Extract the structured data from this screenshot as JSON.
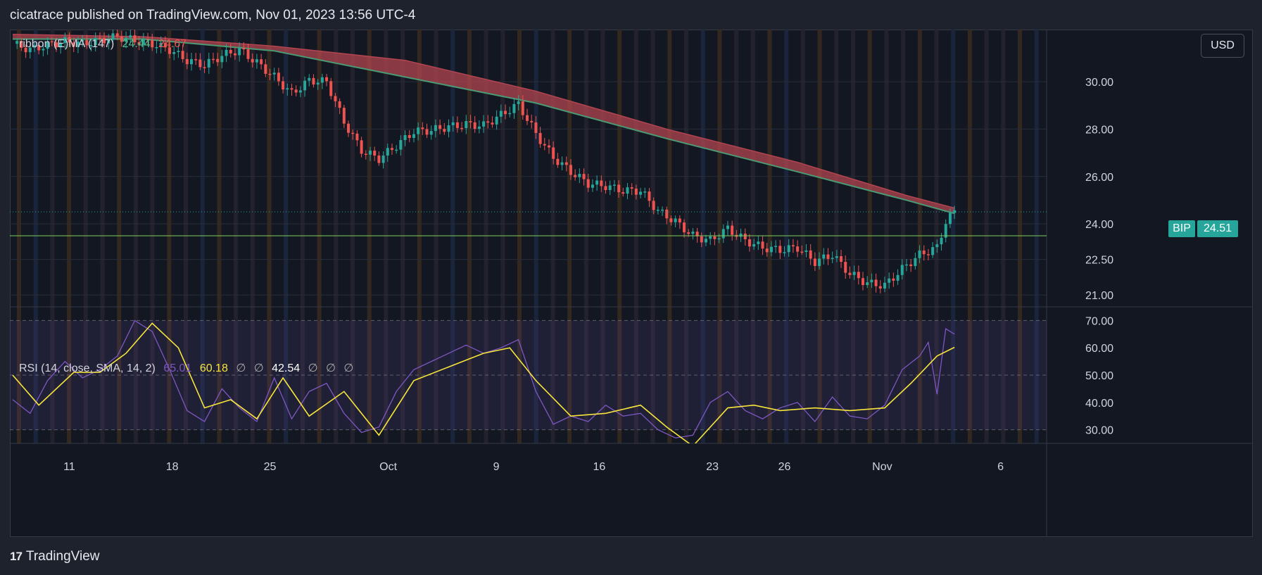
{
  "header": {
    "published_line": "cicatrace published on TradingView.com, Nov 01, 2023 13:56 UTC-4"
  },
  "currency_button": "USD",
  "symbol_badge": {
    "symbol": "BIP",
    "price": "24.51"
  },
  "ribbon_legend": {
    "name": "ribbon (E)MA (147)",
    "value_low": "24.44",
    "value_high": "24.67"
  },
  "rsi_legend": {
    "name": "RSI (14, close, SMA, 14, 2)",
    "rsi_value": "65.01",
    "ma_value": "60.18",
    "empty_1": "∅",
    "empty_2": "∅",
    "extra_value": "42.54",
    "empty_3": "∅",
    "empty_4": "∅",
    "empty_5": "∅"
  },
  "price_axis_labels": [
    "30.00",
    "28.00",
    "26.00",
    "24.00",
    "22.50",
    "21.00"
  ],
  "rsi_axis_labels": [
    "70.00",
    "60.00",
    "50.00",
    "40.00",
    "30.00"
  ],
  "time_axis_labels": [
    "11",
    "18",
    "25",
    "Oct",
    "9",
    "16",
    "23",
    "26",
    "Nov",
    "6"
  ],
  "footer": {
    "brand": "TradingView",
    "logo_mark": "17"
  },
  "colors": {
    "background": "#131722",
    "up": "#26a69a",
    "down": "#ef5350",
    "ribbon_bear": "#b24550",
    "ribbon_bull": "#4a9a74",
    "rsi": "#7e57c2",
    "rsi_ma": "#f7e53b",
    "support": "#7ccf5a"
  },
  "chart_data": [
    {
      "type": "candlestick",
      "series_label": "BIP",
      "x_axis_ticks": [
        "11",
        "18",
        "25",
        "Oct",
        "9",
        "16",
        "23",
        "26",
        "Nov",
        "6"
      ],
      "y_axis_ticks": [
        30.0,
        28.0,
        26.0,
        24.0,
        22.5,
        21.0
      ],
      "y_range": [
        20.5,
        32.2
      ],
      "last_price": 24.51,
      "horizontal_line": 23.5,
      "close_path": [
        {
          "x": 0,
          "y": 31.6
        },
        {
          "x": 4,
          "y": 31.35
        },
        {
          "x": 8,
          "y": 31.55
        },
        {
          "x": 12,
          "y": 31.7
        },
        {
          "x": 16,
          "y": 31.6
        },
        {
          "x": 20,
          "y": 31.75
        },
        {
          "x": 24,
          "y": 31.9
        },
        {
          "x": 28,
          "y": 31.75
        },
        {
          "x": 32,
          "y": 31.6
        },
        {
          "x": 36,
          "y": 31.35
        },
        {
          "x": 40,
          "y": 30.9
        },
        {
          "x": 44,
          "y": 30.7
        },
        {
          "x": 48,
          "y": 31.1
        },
        {
          "x": 52,
          "y": 31.35
        },
        {
          "x": 56,
          "y": 30.8
        },
        {
          "x": 60,
          "y": 30.2
        },
        {
          "x": 64,
          "y": 29.5
        },
        {
          "x": 68,
          "y": 30.05
        },
        {
          "x": 72,
          "y": 30.0
        },
        {
          "x": 76,
          "y": 28.3
        },
        {
          "x": 80,
          "y": 27.1
        },
        {
          "x": 84,
          "y": 26.75
        },
        {
          "x": 88,
          "y": 27.3
        },
        {
          "x": 92,
          "y": 27.9
        },
        {
          "x": 96,
          "y": 27.95
        },
        {
          "x": 100,
          "y": 28.1
        },
        {
          "x": 104,
          "y": 28.2
        },
        {
          "x": 108,
          "y": 28.15
        },
        {
          "x": 112,
          "y": 28.6
        },
        {
          "x": 116,
          "y": 29.05
        },
        {
          "x": 120,
          "y": 27.8
        },
        {
          "x": 124,
          "y": 26.8
        },
        {
          "x": 128,
          "y": 26.2
        },
        {
          "x": 132,
          "y": 25.7
        },
        {
          "x": 136,
          "y": 25.6
        },
        {
          "x": 140,
          "y": 25.4
        },
        {
          "x": 144,
          "y": 25.4
        },
        {
          "x": 148,
          "y": 24.55
        },
        {
          "x": 152,
          "y": 24.1
        },
        {
          "x": 156,
          "y": 23.5
        },
        {
          "x": 160,
          "y": 23.3
        },
        {
          "x": 164,
          "y": 23.8
        },
        {
          "x": 168,
          "y": 23.3
        },
        {
          "x": 172,
          "y": 23.0
        },
        {
          "x": 176,
          "y": 22.9
        },
        {
          "x": 180,
          "y": 23.0
        },
        {
          "x": 184,
          "y": 22.4
        },
        {
          "x": 188,
          "y": 22.7
        },
        {
          "x": 192,
          "y": 21.9
        },
        {
          "x": 196,
          "y": 21.5
        },
        {
          "x": 200,
          "y": 21.4
        },
        {
          "x": 204,
          "y": 22.1
        },
        {
          "x": 208,
          "y": 22.7
        },
        {
          "x": 212,
          "y": 23.0
        },
        {
          "x": 214,
          "y": 24.1
        },
        {
          "x": 216,
          "y": 24.51
        }
      ],
      "ema_ribbon": {
        "upper": [
          {
            "x": 0,
            "y": 32.0
          },
          {
            "x": 30,
            "y": 31.9
          },
          {
            "x": 60,
            "y": 31.5
          },
          {
            "x": 90,
            "y": 30.9
          },
          {
            "x": 120,
            "y": 29.6
          },
          {
            "x": 150,
            "y": 28.0
          },
          {
            "x": 180,
            "y": 26.6
          },
          {
            "x": 205,
            "y": 25.2
          },
          {
            "x": 216,
            "y": 24.67
          }
        ],
        "lower": [
          {
            "x": 0,
            "y": 31.8
          },
          {
            "x": 30,
            "y": 31.8
          },
          {
            "x": 60,
            "y": 31.3
          },
          {
            "x": 90,
            "y": 30.2
          },
          {
            "x": 120,
            "y": 29.1
          },
          {
            "x": 150,
            "y": 27.6
          },
          {
            "x": 180,
            "y": 26.2
          },
          {
            "x": 205,
            "y": 25.0
          },
          {
            "x": 216,
            "y": 24.44
          }
        ]
      }
    },
    {
      "type": "line",
      "series_label": "RSI (14, close, SMA, 14, 2)",
      "y_axis_ticks": [
        70.0,
        60.0,
        50.0,
        40.0,
        30.0
      ],
      "y_range": [
        25,
        75
      ],
      "bands": [
        30,
        50,
        70
      ],
      "series": [
        {
          "name": "RSI",
          "points": [
            {
              "x": 0,
              "y": 41
            },
            {
              "x": 4,
              "y": 36
            },
            {
              "x": 8,
              "y": 48
            },
            {
              "x": 12,
              "y": 55
            },
            {
              "x": 16,
              "y": 49
            },
            {
              "x": 20,
              "y": 52
            },
            {
              "x": 24,
              "y": 57
            },
            {
              "x": 28,
              "y": 70
            },
            {
              "x": 32,
              "y": 66
            },
            {
              "x": 36,
              "y": 52
            },
            {
              "x": 40,
              "y": 37
            },
            {
              "x": 44,
              "y": 33
            },
            {
              "x": 48,
              "y": 45
            },
            {
              "x": 52,
              "y": 38
            },
            {
              "x": 56,
              "y": 33
            },
            {
              "x": 60,
              "y": 49
            },
            {
              "x": 64,
              "y": 34
            },
            {
              "x": 68,
              "y": 44
            },
            {
              "x": 72,
              "y": 47
            },
            {
              "x": 76,
              "y": 36
            },
            {
              "x": 80,
              "y": 29
            },
            {
              "x": 84,
              "y": 31
            },
            {
              "x": 88,
              "y": 44
            },
            {
              "x": 92,
              "y": 52
            },
            {
              "x": 96,
              "y": 55
            },
            {
              "x": 100,
              "y": 58
            },
            {
              "x": 104,
              "y": 61
            },
            {
              "x": 108,
              "y": 58
            },
            {
              "x": 112,
              "y": 60
            },
            {
              "x": 116,
              "y": 63
            },
            {
              "x": 120,
              "y": 44
            },
            {
              "x": 124,
              "y": 32
            },
            {
              "x": 128,
              "y": 35
            },
            {
              "x": 132,
              "y": 33
            },
            {
              "x": 136,
              "y": 39
            },
            {
              "x": 140,
              "y": 35
            },
            {
              "x": 144,
              "y": 36
            },
            {
              "x": 148,
              "y": 30
            },
            {
              "x": 152,
              "y": 27
            },
            {
              "x": 156,
              "y": 28
            },
            {
              "x": 160,
              "y": 40
            },
            {
              "x": 164,
              "y": 44
            },
            {
              "x": 168,
              "y": 37
            },
            {
              "x": 172,
              "y": 34
            },
            {
              "x": 176,
              "y": 38
            },
            {
              "x": 180,
              "y": 40
            },
            {
              "x": 184,
              "y": 33
            },
            {
              "x": 188,
              "y": 42
            },
            {
              "x": 192,
              "y": 35
            },
            {
              "x": 196,
              "y": 34
            },
            {
              "x": 200,
              "y": 39
            },
            {
              "x": 204,
              "y": 52
            },
            {
              "x": 208,
              "y": 57
            },
            {
              "x": 210,
              "y": 62
            },
            {
              "x": 212,
              "y": 43
            },
            {
              "x": 214,
              "y": 67
            },
            {
              "x": 216,
              "y": 65
            }
          ]
        },
        {
          "name": "RSI MA",
          "points": [
            {
              "x": 0,
              "y": 50
            },
            {
              "x": 6,
              "y": 39
            },
            {
              "x": 14,
              "y": 51
            },
            {
              "x": 20,
              "y": 51
            },
            {
              "x": 26,
              "y": 58
            },
            {
              "x": 32,
              "y": 69
            },
            {
              "x": 38,
              "y": 60
            },
            {
              "x": 44,
              "y": 38
            },
            {
              "x": 50,
              "y": 41
            },
            {
              "x": 56,
              "y": 34
            },
            {
              "x": 62,
              "y": 49
            },
            {
              "x": 68,
              "y": 35
            },
            {
              "x": 76,
              "y": 44
            },
            {
              "x": 84,
              "y": 28
            },
            {
              "x": 92,
              "y": 48
            },
            {
              "x": 100,
              "y": 53
            },
            {
              "x": 108,
              "y": 58
            },
            {
              "x": 114,
              "y": 60
            },
            {
              "x": 120,
              "y": 48
            },
            {
              "x": 128,
              "y": 35
            },
            {
              "x": 136,
              "y": 36
            },
            {
              "x": 144,
              "y": 39
            },
            {
              "x": 150,
              "y": 31
            },
            {
              "x": 156,
              "y": 24
            },
            {
              "x": 164,
              "y": 38
            },
            {
              "x": 170,
              "y": 39
            },
            {
              "x": 176,
              "y": 37
            },
            {
              "x": 184,
              "y": 38
            },
            {
              "x": 192,
              "y": 37
            },
            {
              "x": 200,
              "y": 38
            },
            {
              "x": 206,
              "y": 47
            },
            {
              "x": 212,
              "y": 57
            },
            {
              "x": 216,
              "y": 60.18
            }
          ]
        }
      ]
    }
  ]
}
